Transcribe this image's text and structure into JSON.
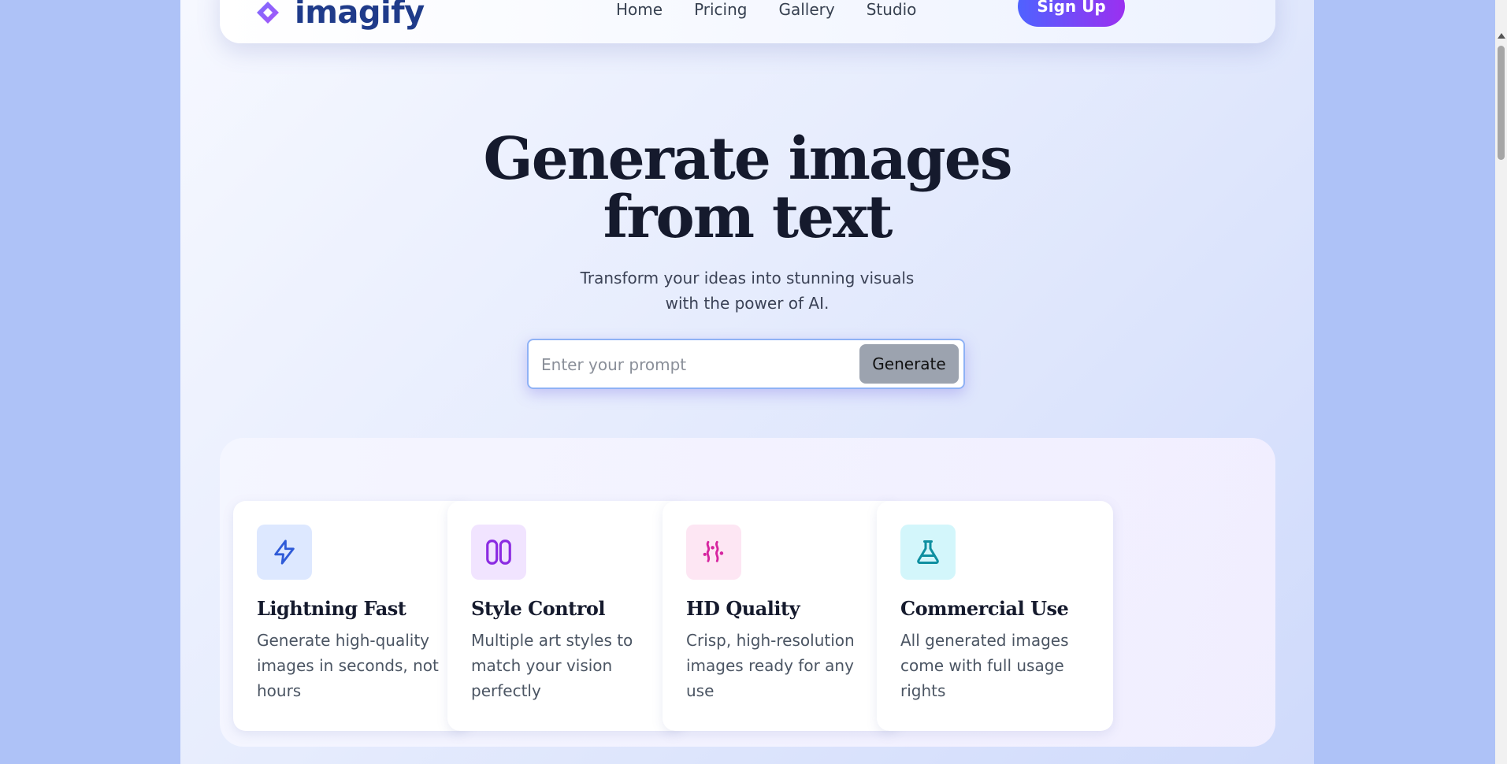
{
  "brand": {
    "name": "imagify",
    "logo_icon": "diamond-logo-icon",
    "colors": {
      "brand_text": "#1f3b8a",
      "logo_gradient": [
        "#7b6cff",
        "#a855f7"
      ]
    }
  },
  "nav": {
    "links": [
      "Home",
      "Pricing",
      "Gallery",
      "Studio"
    ],
    "signup_label": "Sign Up"
  },
  "hero": {
    "title_line1": "Generate images",
    "title_line2": "from text",
    "subtitle_line1": "Transform your ideas into stunning visuals",
    "subtitle_line2": "with the power of AI.",
    "prompt_placeholder": "Enter your prompt",
    "prompt_value": "",
    "generate_label": "Generate"
  },
  "features": [
    {
      "title": "Lightning Fast",
      "desc": "Generate high-quality images in seconds, not hours",
      "icon": "lightning-icon",
      "icon_bg": "#dde8ff",
      "icon_color": "#2f5bd8"
    },
    {
      "title": "Style Control",
      "desc": "Multiple art styles to match your vision perfectly",
      "icon": "columns-icon",
      "icon_bg": "#f1e4ff",
      "icon_color": "#8b2be2"
    },
    {
      "title": "HD Quality",
      "desc": "Crisp, high-resolution images ready for any use",
      "icon": "sparkle-brush-icon",
      "icon_bg": "#fde6f3",
      "icon_color": "#d6249f"
    },
    {
      "title": "Commercial Use",
      "desc": "All generated images come with full usage rights",
      "icon": "flask-icon",
      "icon_bg": "#d3f6fb",
      "icon_color": "#0e8fa0"
    }
  ]
}
